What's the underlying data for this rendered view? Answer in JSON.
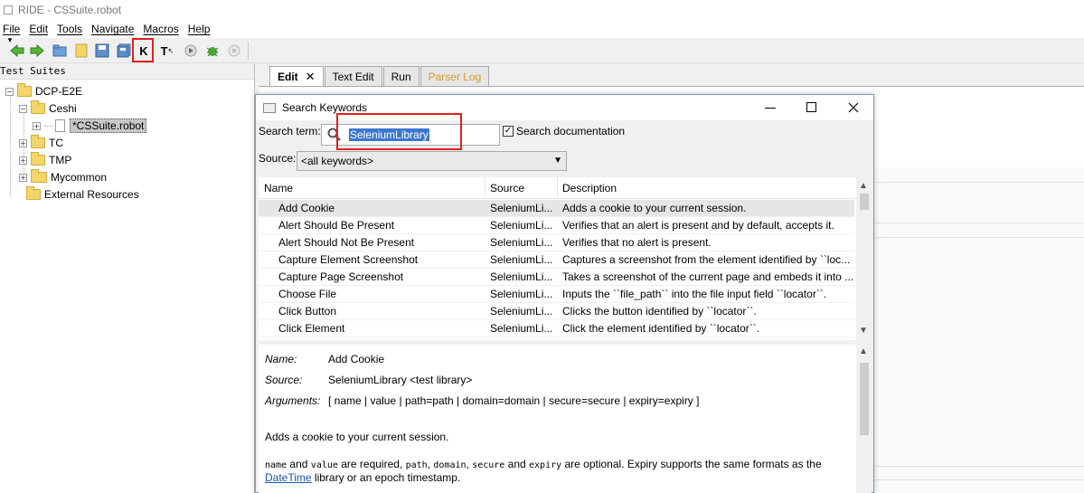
{
  "window": {
    "title": "RIDE - CSSuite.robot"
  },
  "menu": [
    "File",
    "Edit",
    "Tools",
    "Navigate",
    "Macros",
    "Help"
  ],
  "toolbar": {
    "k_label": "K",
    "t_label": "T"
  },
  "tree": {
    "header": "Test Suites",
    "nodes": [
      "DCP-E2E",
      "Ceshi",
      "*CSSuite.robot",
      "TC",
      "TMP",
      "Mycommon",
      "External Resources"
    ]
  },
  "editor_tabs": [
    {
      "label": "Edit"
    },
    {
      "label": "Text Edit"
    },
    {
      "label": "Run"
    },
    {
      "label": "Parser Log"
    }
  ],
  "dialog": {
    "title": "Search Keywords",
    "search_label": "Search term:",
    "search_value": "SeleniumLibrary",
    "search_doc_label": "Search documentation",
    "search_doc_checked": true,
    "source_label": "Source:",
    "source_value": "<all keywords>",
    "columns": [
      "Name",
      "Source",
      "Description"
    ],
    "rows": [
      {
        "name": "Add Cookie",
        "source": "SeleniumLi...",
        "desc": "Adds a cookie to your current session."
      },
      {
        "name": "Alert Should Be Present",
        "source": "SeleniumLi...",
        "desc": "Verifies that an alert is present and by default, accepts it."
      },
      {
        "name": "Alert Should Not Be Present",
        "source": "SeleniumLi...",
        "desc": "Verifies that no alert is present."
      },
      {
        "name": "Capture Element Screenshot",
        "source": "SeleniumLi...",
        "desc": "Captures a screenshot from the element identified by ``loc..."
      },
      {
        "name": "Capture Page Screenshot",
        "source": "SeleniumLi...",
        "desc": "Takes a screenshot of the current page and embeds it into ..."
      },
      {
        "name": "Choose File",
        "source": "SeleniumLi...",
        "desc": "Inputs the ``file_path`` into the file input field ``locator``."
      },
      {
        "name": "Click Button",
        "source": "SeleniumLi...",
        "desc": "Clicks the button identified by ``locator``."
      },
      {
        "name": "Click Element",
        "source": "SeleniumLi...",
        "desc": "Click the element identified by ``locator``."
      }
    ],
    "details": {
      "name_label": "Name:",
      "name_value": "Add Cookie",
      "source_label": "Source:",
      "source_value": "SeleniumLibrary <test library>",
      "args_label": "Arguments:",
      "args_value": "[ name | value | path=path | domain=domain | secure=secure | expiry=expiry ]",
      "summary": "Adds a cookie to your current session.",
      "p_code1": "name",
      "p_and1": " and ",
      "p_code2": "value",
      "p_mid": " are required, ",
      "p_code3": "path",
      "p_c1": ", ",
      "p_code4": "domain",
      "p_c2": ", ",
      "p_code5": "secure",
      "p_and2": " and ",
      "p_code6": "expiry",
      "p_tail": " are optional. Expiry supports the same formats as the",
      "p2_link": "DateTime",
      "p2_tail": " library or an epoch timestamp."
    }
  },
  "colors": {
    "highlight_red": "#e0201c",
    "selection_blue": "#3b77d0",
    "link_blue": "#1a55b8",
    "disabled_tab": "#d89b2a"
  }
}
